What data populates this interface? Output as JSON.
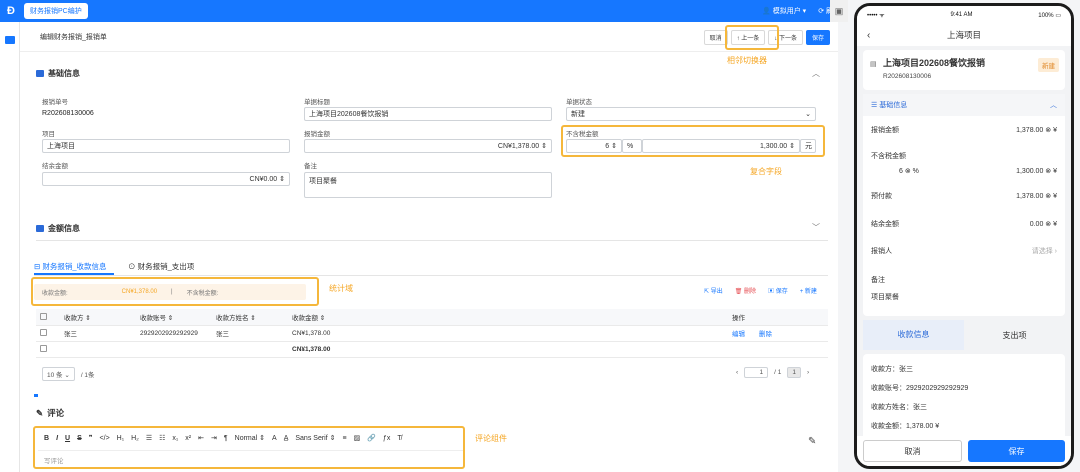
{
  "top": {
    "app_button": "财务报销PC编护",
    "user": "模拟用户",
    "refresh": "刷新"
  },
  "toolbar": {
    "breadcrumb": "编辑财务报销_报销单",
    "cancel": "取消",
    "prev": "上一条",
    "next": "下一条",
    "save": "保存"
  },
  "annotations": {
    "nav_switcher": "相邻切换器",
    "compound_field": "复合字段",
    "stats": "统计域",
    "comment": "评论组件"
  },
  "basic": {
    "title": "基础信息",
    "fields": {
      "no_label": "报销单号",
      "no_value": "R202608130006",
      "subject_label": "单据标题",
      "subject_value": "上海项目202608餐饮报销",
      "status_label": "单据状态",
      "status_value": "新建",
      "project_label": "项目",
      "project_value": "上海项目",
      "amount_label": "报销金额",
      "amount_value": "CN¥1,378.00",
      "pretax_label": "不含税金额",
      "tax_rate": "6",
      "tax_unit": "%",
      "pretax_value": "1,300.00",
      "pretax_unit": "元",
      "balance_label": "结余金额",
      "balance_value": "CN¥0.00",
      "note_label": "备注",
      "note_value": "项目聚餐"
    }
  },
  "amount_section": {
    "title": "金额信息"
  },
  "tabs": [
    {
      "label": "财务报销_收款信息"
    },
    {
      "label": "财务报销_支出项"
    }
  ],
  "stats": {
    "received_label": "收款金额:",
    "received_value": "CN¥1,378.00",
    "pretax_label": "不含税金额:"
  },
  "actions": {
    "export": "导出",
    "delete": "删除",
    "save": "保存",
    "add": "新建"
  },
  "table": {
    "headers": [
      "收款方",
      "收款账号",
      "收款方姓名",
      "收款金额",
      "操作"
    ],
    "rows": [
      {
        "payee": "张三",
        "account": "2929202929292929",
        "name": "张三",
        "amount": "CN¥1,378.00",
        "edit": "编辑",
        "del": "删除"
      }
    ],
    "total": "CN¥1,378.00"
  },
  "pager": {
    "size": "10 条",
    "total": "/ 1条",
    "page": "1",
    "pages": "/ 1",
    "current": "1"
  },
  "comment": {
    "title": "评论",
    "placeholder": "写评论",
    "heading": "Normal",
    "font": "Sans Serif"
  },
  "phone": {
    "time": "9:41 AM",
    "battery": "100%",
    "nav_title": "上海项目",
    "doc_title": "上海项目202608餐饮报销",
    "doc_no": "R202608130006",
    "status": "新建",
    "section": "基础信息",
    "amount_label": "报销金额",
    "amount_value": "1,378.00",
    "pretax_label": "不含税金额",
    "tax_rate": "6",
    "tax_unit": "%",
    "pretax_value": "1,300.00",
    "prepay_label": "预付款",
    "prepay_value": "1,378.00",
    "balance_label": "结余金额",
    "balance_value": "0.00",
    "person_label": "报销人",
    "person_placeholder": "请选择",
    "note_label": "备注",
    "note_value": "项目聚餐",
    "tab1": "收款信息",
    "tab2": "支出项",
    "payee": "收款方：张三",
    "account": "收款账号：2929202929292929",
    "name": "收款方姓名：张三",
    "amount": "收款金额：1,378.00 ¥",
    "cancel": "取消",
    "save": "保存",
    "currency": "¥"
  }
}
